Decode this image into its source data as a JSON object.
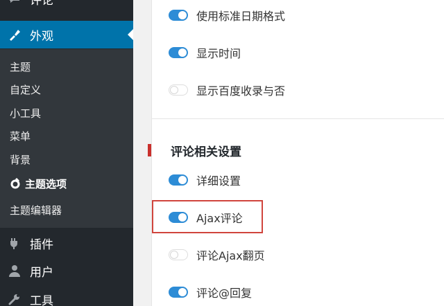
{
  "sidebar": {
    "comments_label": "评论",
    "appearance_label": "外观",
    "submenu": [
      {
        "label": "主题"
      },
      {
        "label": "自定义"
      },
      {
        "label": "小工具"
      },
      {
        "label": "菜单"
      },
      {
        "label": "背景"
      },
      {
        "label": "主题选项"
      },
      {
        "label": "主题编辑器"
      }
    ],
    "plugins_label": "插件",
    "users_label": "用户",
    "tools_label": "工具"
  },
  "settings_top": [
    {
      "label": "使用标准日期格式",
      "enabled": true
    },
    {
      "label": "显示时间",
      "enabled": true
    },
    {
      "label": "显示百度收录与否",
      "enabled": false
    }
  ],
  "comments_section": {
    "title": "评论相关设置",
    "items": [
      {
        "label": "详细设置",
        "enabled": true
      },
      {
        "label": "Ajax评论",
        "enabled": true
      },
      {
        "label": "评论Ajax翻页",
        "enabled": false
      },
      {
        "label": "评论@回复",
        "enabled": true
      }
    ]
  },
  "colors": {
    "sidebar_bg": "#23282d",
    "submenu_bg": "#32373c",
    "active_blue": "#0073aa",
    "toggle_on": "#2d8cd6",
    "highlight_red": "#d0443c"
  }
}
